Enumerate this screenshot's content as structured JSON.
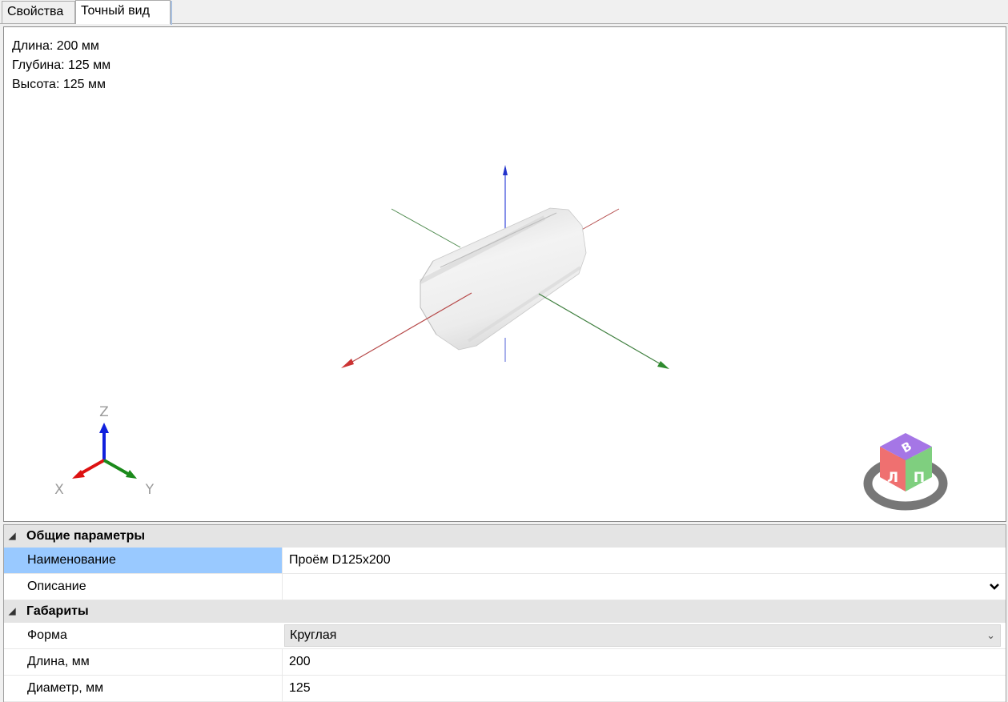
{
  "tabs": [
    {
      "label": "Свойства",
      "active": false
    },
    {
      "label": "Точный вид",
      "active": true
    }
  ],
  "viewport": {
    "dimensions": {
      "length": "Длина: 200 мм",
      "depth": "Глубина: 125 мм",
      "height": "Высота: 125 мм"
    },
    "axis_gizmo": {
      "z": "Z",
      "x": "X",
      "y": "Y"
    },
    "view_cube": {
      "top": "В",
      "left": "Л",
      "right": "П"
    },
    "colors": {
      "x_axis": "#cc3333",
      "y_axis": "#2e8b2e",
      "z_axis": "#2233cc"
    }
  },
  "properties": {
    "general": {
      "title": "Общие параметры",
      "name_label": "Наименование",
      "name_value": "Проём D125x200",
      "description_label": "Описание",
      "description_value": ""
    },
    "dimensions": {
      "title": "Габариты",
      "shape_label": "Форма",
      "shape_value": "Круглая",
      "length_label": "Длина, мм",
      "length_value": "200",
      "diameter_label": "Диаметр, мм",
      "diameter_value": "125"
    }
  }
}
